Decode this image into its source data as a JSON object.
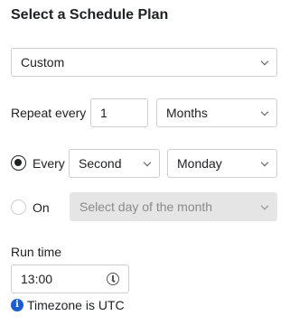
{
  "title": "Select a Schedule Plan",
  "plan_select": {
    "value": "Custom",
    "icon": "chevron-down-icon"
  },
  "repeat": {
    "label": "Repeat every",
    "count": "1",
    "unit": "Months"
  },
  "every_option": {
    "checked": true,
    "label": "Every",
    "ordinal": "Second",
    "weekday": "Monday"
  },
  "on_option": {
    "checked": false,
    "label": "On",
    "day_placeholder": "Select day of the month"
  },
  "run_time": {
    "label": "Run time",
    "value": "13:00",
    "icon": "clock-icon"
  },
  "timezone_note": {
    "icon": "info-icon",
    "text": "Timezone is UTC"
  },
  "colors": {
    "text": "#202124",
    "border": "#cfcfcf",
    "disabled_bg": "#e5e5e5",
    "info_blue": "#1a5fd0"
  }
}
